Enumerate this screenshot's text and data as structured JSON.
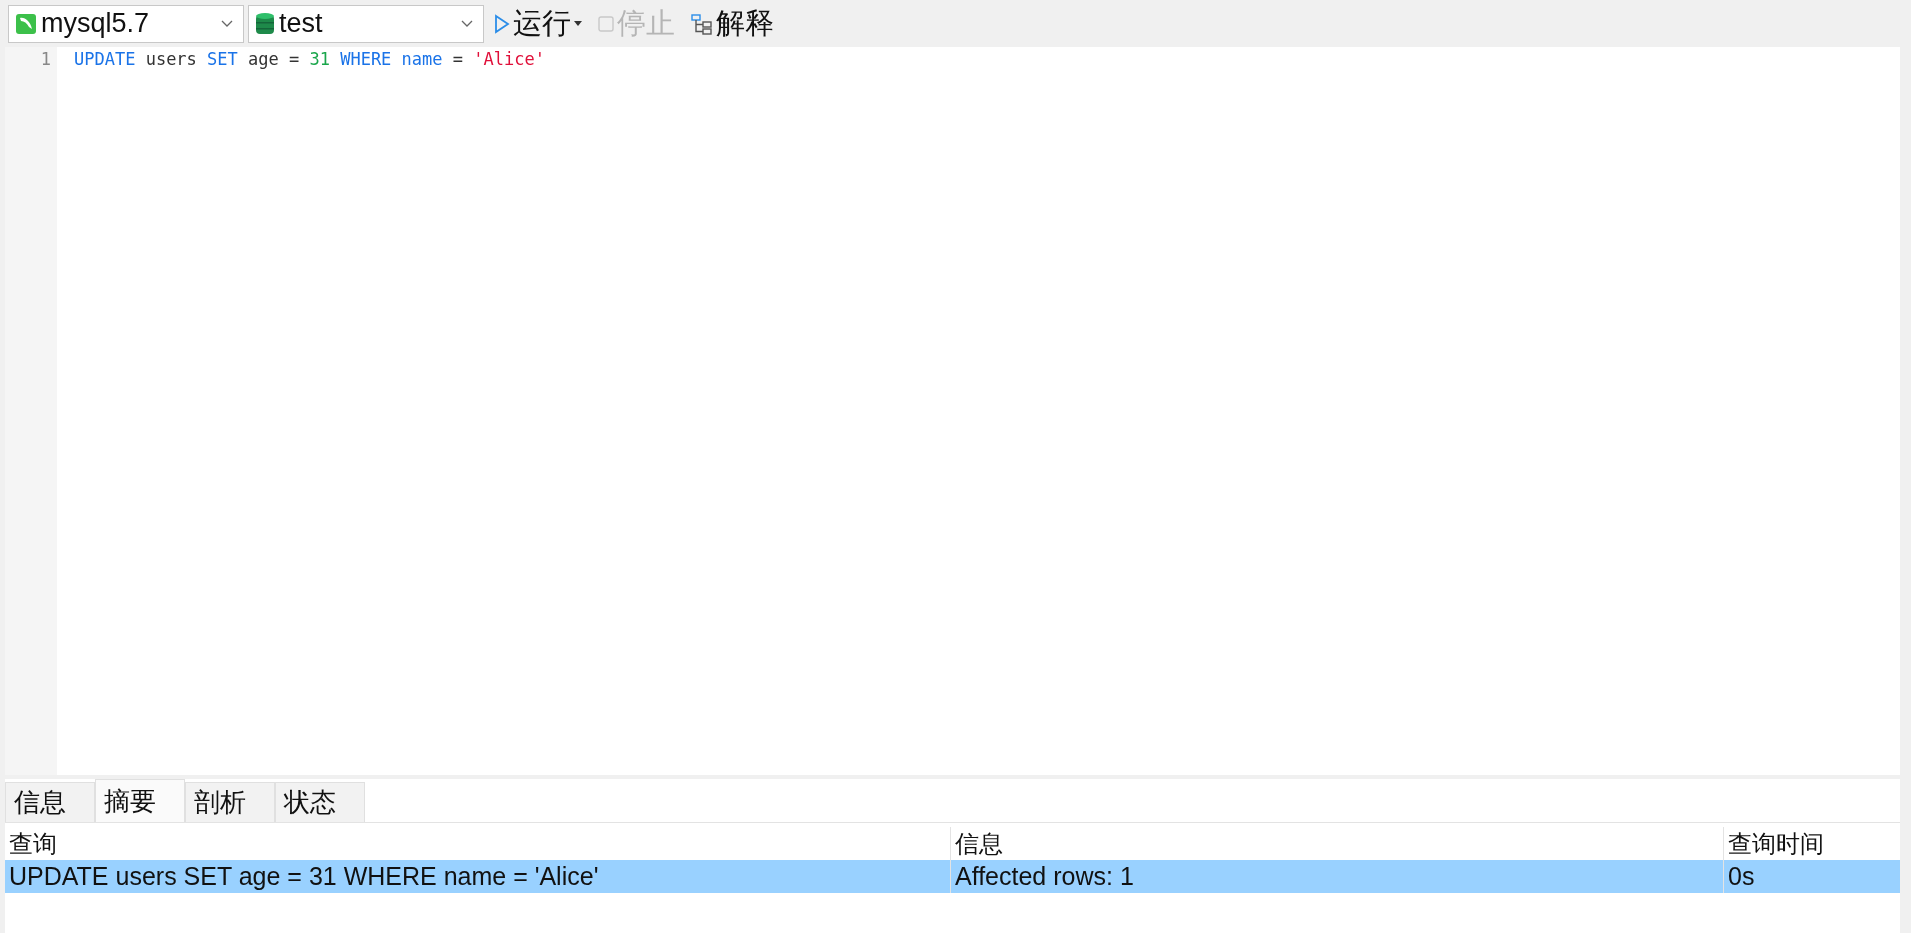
{
  "toolbar": {
    "connection": {
      "value": "mysql5.7"
    },
    "database": {
      "value": "test"
    },
    "buttons": [
      {
        "kind": "run",
        "label": "运行",
        "disabled": false,
        "dropdown": true
      },
      {
        "kind": "stop",
        "label": "停止",
        "disabled": true,
        "dropdown": false
      },
      {
        "kind": "explain",
        "label": "解释",
        "disabled": false,
        "dropdown": false
      }
    ]
  },
  "editor": {
    "lines": [
      {
        "number": "1",
        "tokens": [
          {
            "kind": "keyword",
            "text": "UPDATE"
          },
          {
            "kind": "plain",
            "text": " users "
          },
          {
            "kind": "keyword",
            "text": "SET"
          },
          {
            "kind": "plain",
            "text": " age = "
          },
          {
            "kind": "number",
            "text": "31"
          },
          {
            "kind": "keyword",
            "text": " WHERE"
          },
          {
            "kind": "identifier",
            "text": " name"
          },
          {
            "kind": "plain",
            "text": " = "
          },
          {
            "kind": "string",
            "text": "'Alice'"
          }
        ]
      }
    ]
  },
  "result_tabs": [
    {
      "label": "信息",
      "selected": false
    },
    {
      "label": "摘要",
      "selected": true
    },
    {
      "label": "剖析",
      "selected": false
    },
    {
      "label": "状态",
      "selected": false
    }
  ],
  "table": {
    "columns": [
      "查询",
      "信息",
      "查询时间"
    ],
    "rows": [
      {
        "selected": true,
        "cells": [
          "UPDATE users SET age = 31 WHERE name = 'Alice'",
          "Affected rows: 1",
          "0s"
        ]
      }
    ]
  }
}
